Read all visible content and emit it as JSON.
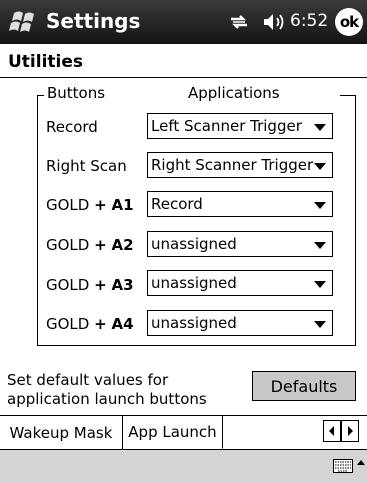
{
  "titlebar": {
    "app_title": "Settings",
    "clock": "6:52",
    "ok_label": "ok"
  },
  "page": {
    "title": "Utilities"
  },
  "group": {
    "buttons_header": "Buttons",
    "applications_header": "Applications"
  },
  "rows": [
    {
      "label": "Record",
      "value": "Left Scanner Trigger"
    },
    {
      "label_prefix": "Right Scan",
      "value": "Right Scanner Trigger"
    },
    {
      "label_prefix": "GOLD",
      "label_plus": "+",
      "label_key": "A1",
      "value": "Record"
    },
    {
      "label_prefix": "GOLD",
      "label_plus": "+",
      "label_key": "A2",
      "value": "unassigned"
    },
    {
      "label_prefix": "GOLD",
      "label_plus": "+",
      "label_key": "A3",
      "value": "unassigned"
    },
    {
      "label_prefix": "GOLD",
      "label_plus": "+",
      "label_key": "A4",
      "value": "unassigned"
    }
  ],
  "defaults": {
    "note_line1": "Set default values for",
    "note_line2": "application launch buttons",
    "button_label": "Defaults"
  },
  "tabs": [
    {
      "label": "Wakeup Mask"
    },
    {
      "label": "App Launch",
      "selected": true
    }
  ],
  "icons": {
    "start": "windows-flag-icon",
    "connectivity": "connectivity-icon",
    "volume": "speaker-icon",
    "keyboard": "keyboard-icon"
  }
}
